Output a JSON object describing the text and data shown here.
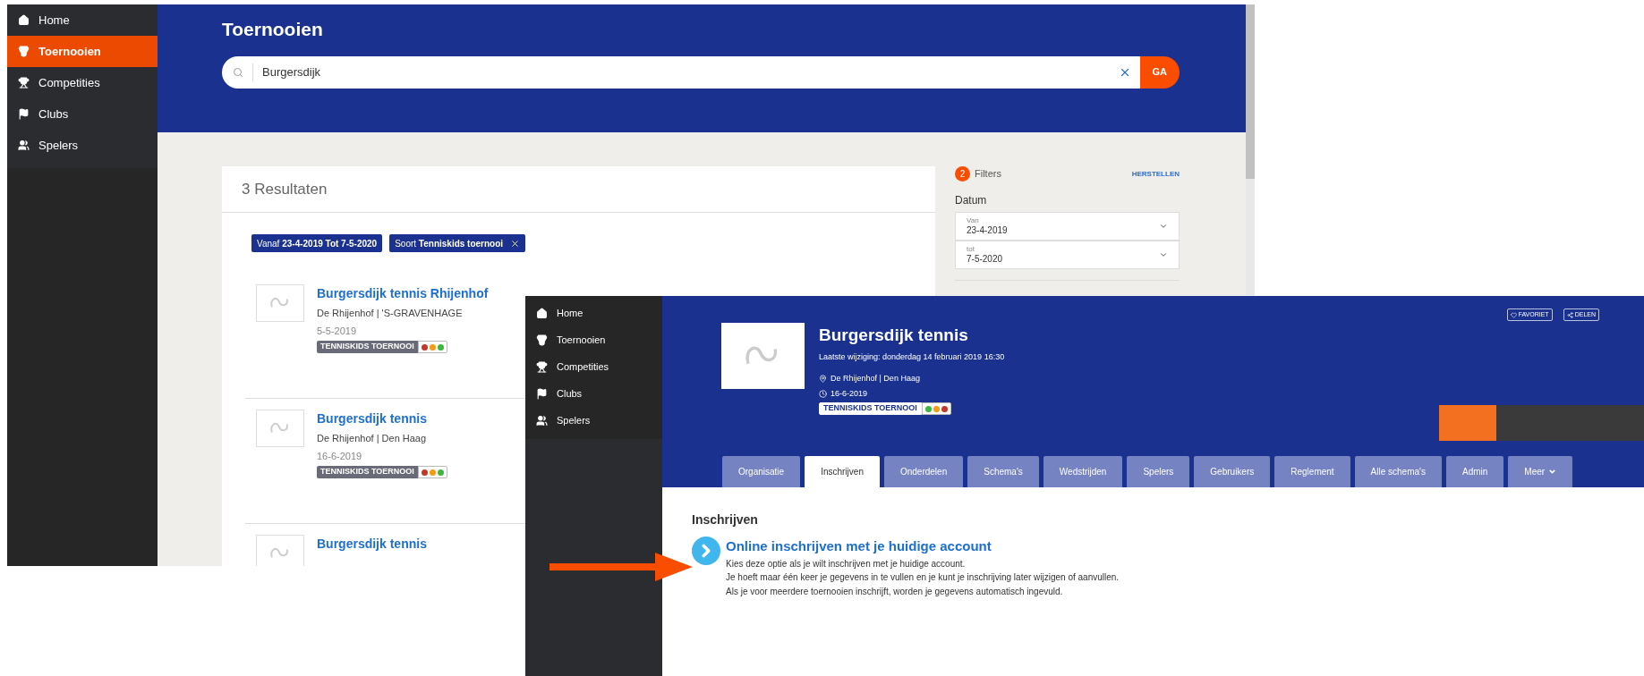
{
  "back_window": {
    "sidebar": {
      "items": [
        {
          "label": "Home",
          "selected": false
        },
        {
          "label": "Toernooien",
          "selected": true
        },
        {
          "label": "Competities",
          "selected": false
        },
        {
          "label": "Clubs",
          "selected": false
        },
        {
          "label": "Spelers",
          "selected": false
        }
      ]
    },
    "header": {
      "title": "Toernooien",
      "search": {
        "value": "Burgersdijk"
      },
      "go_button": "GA"
    },
    "results": {
      "count_title": "3 Resultaten",
      "filter_chips": [
        {
          "label": "Vanaf **23-4-2019 Tot 7-5-2020**",
          "removable": false
        },
        {
          "label": "Soort **Tenniskids toernooi**",
          "removable": true
        }
      ],
      "items": [
        {
          "title": "Burgersdijk tennis Rhijenhof",
          "location": "De Rhijenhof | 'S-GRAVENHAGE",
          "date": "5-5-2019",
          "tag": "TENNISKIDS TOERNOOI",
          "dots": [
            {
              "color": "#c0392b"
            },
            {
              "color": "#f39c12"
            },
            {
              "color": "#3cb73c"
            }
          ]
        },
        {
          "title": "Burgersdijk tennis",
          "location": "De Rhijenhof | Den Haag",
          "date": "16-6-2019",
          "tag": "TENNISKIDS TOERNOOI",
          "dots": [
            {
              "color": "#c0392b"
            },
            {
              "color": "#f39c12"
            },
            {
              "color": "#3cb73c"
            }
          ]
        },
        {
          "title": "Burgersdijk tennis"
        }
      ]
    },
    "filters": {
      "count": "2",
      "label": "Filters",
      "reset": "HERSTELLEN",
      "section": "Datum",
      "fields": [
        {
          "label": "Van",
          "value": "23-4-2019"
        },
        {
          "label": "tot",
          "value": "7-5-2020"
        }
      ]
    }
  },
  "front_window": {
    "sidebar": {
      "items": [
        {
          "label": "Home",
          "selected": false
        },
        {
          "label": "Toernooien",
          "selected": false
        },
        {
          "label": "Competities",
          "selected": false
        },
        {
          "label": "Clubs",
          "selected": false
        },
        {
          "label": "Spelers",
          "selected": false
        }
      ]
    },
    "tournament": {
      "title": "Burgersdijk tennis",
      "last_modified": "Laatste wijziging: donderdag 14 februari 2019 16:30",
      "location": "De Rhijenhof | Den Haag",
      "date": "16-6-2019",
      "tag": "TENNISKIDS TOERNOOI",
      "dots": [
        {
          "color": "#3cb73c"
        },
        {
          "color": "#f39c12"
        },
        {
          "color": "#c0392b"
        }
      ]
    },
    "actions": [
      {
        "kind": "heart",
        "label": "FAVORIET"
      },
      {
        "kind": "share",
        "label": "DELEN"
      }
    ],
    "tabs": [
      {
        "label": "Organisatie",
        "selected": false
      },
      {
        "label": "Inschrijven",
        "selected": true
      },
      {
        "label": "Onderdelen",
        "selected": false
      },
      {
        "label": "Schema's",
        "selected": false
      },
      {
        "label": "Wedstrijden",
        "selected": false
      },
      {
        "label": "Spelers",
        "selected": false
      },
      {
        "label": "Gebruikers",
        "selected": false
      },
      {
        "label": "Reglement",
        "selected": false
      },
      {
        "label": "Alle schema's",
        "selected": false
      },
      {
        "label": "Admin",
        "selected": false
      },
      {
        "label": "Meer",
        "selected": false,
        "dropdown": true
      }
    ],
    "content": {
      "heading": "Inschrijven",
      "option": {
        "title": "Online inschrijven met je huidige account",
        "lines": [
          "Kies deze optie als je wilt inschrijven met je huidige account.",
          "Je hoeft maar één keer je gegevens in te vullen en je kunt je inschrijving later wijzigen of aanvullen.",
          "Als je voor meerdere toernooien inschrijft, worden je gegevens automatisch ingevuld."
        ]
      }
    }
  }
}
